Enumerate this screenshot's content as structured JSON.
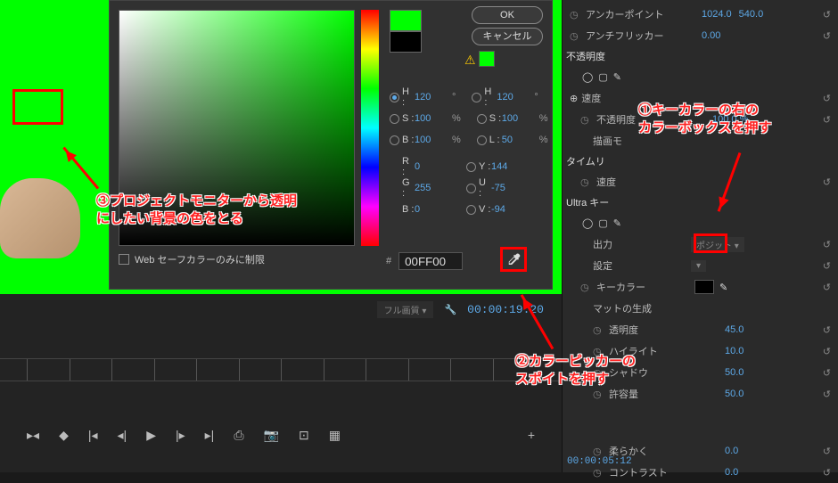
{
  "dialog": {
    "ok": "OK",
    "cancel": "キャンセル",
    "hex": "00FF00",
    "webonly": "Web セーフカラーのみに制限",
    "H1": {
      "label": "H :",
      "val": "120",
      "unit": "°"
    },
    "S1": {
      "label": "S :",
      "val": "100",
      "unit": "%"
    },
    "B1": {
      "label": "B :",
      "val": "100",
      "unit": "%"
    },
    "H2": {
      "label": "H :",
      "val": "120",
      "unit": "°"
    },
    "S2": {
      "label": "S :",
      "val": "100",
      "unit": "%"
    },
    "L2": {
      "label": "L :",
      "val": "50",
      "unit": "%"
    },
    "Y": {
      "label": "Y :",
      "val": "144"
    },
    "U": {
      "label": "U :",
      "val": "-75"
    },
    "V": {
      "label": "V :",
      "val": "-94"
    },
    "R": {
      "label": "R :",
      "val": "0"
    },
    "G": {
      "label": "G :",
      "val": "255"
    },
    "B": {
      "label": "B :",
      "val": "0"
    }
  },
  "timeline": {
    "dropdown": "フル画質",
    "timecode": "00:00:19:20",
    "bottom_tc": "00:00:05:12"
  },
  "fx": {
    "anchor": {
      "label": "アンカーポイント",
      "v1": "1024.0",
      "v2": "540.0"
    },
    "antiflicker": {
      "label": "アンチフリッカー",
      "val": "0.00"
    },
    "opacity_section": "不透明度",
    "speed": "速度",
    "opacity": {
      "label": "不透明度",
      "val": "100.0 %"
    },
    "drawmode": "描画モ",
    "timeremapping": "タイムリ",
    "ultrakey": "Ultra キー",
    "output": {
      "label": "出力",
      "val": "ポジット"
    },
    "setting": {
      "label": "設定",
      "val": ""
    },
    "keycolor": "キーカラー",
    "mattegen": "マットの生成",
    "transparency": {
      "label": "透明度",
      "val": "45.0"
    },
    "highlight": {
      "label": "ハイライト",
      "val": "10.0"
    },
    "shadow": {
      "label": "シャドウ",
      "val": "50.0"
    },
    "tolerance": {
      "label": "許容量",
      "val": "50.0"
    },
    "softness": {
      "label": "柔らかく",
      "val": "0.0"
    },
    "contrast": {
      "label": "コントラスト",
      "val": "0.0"
    }
  },
  "annotations": {
    "a1": "①キーカラーの右の\nカラーボックスを押す",
    "a2": "②カラーピッカーの\nスポイトを押す",
    "a3": "③プロジェクトモニターから透明\nにしたい背景の色をとる"
  }
}
